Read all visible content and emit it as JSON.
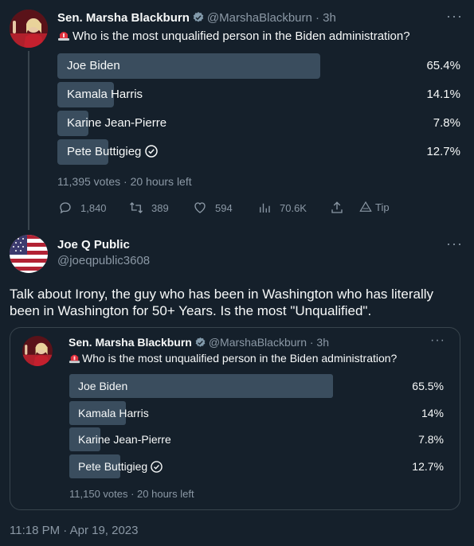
{
  "main_tweet": {
    "author_name": "Sen. Marsha Blackburn",
    "handle_time": "@MarshaBlackburn · 3h",
    "text": "Who is the most unqualified person in the Biden administration?",
    "poll": {
      "options": [
        {
          "label": "Joe Biden",
          "percent": "65.4%",
          "fraction": 0.654
        },
        {
          "label": "Kamala Harris",
          "percent": "14.1%",
          "fraction": 0.141
        },
        {
          "label": "Karine Jean-Pierre",
          "percent": "7.8%",
          "fraction": 0.078
        },
        {
          "label": "Pete Buttigieg",
          "percent": "12.7%",
          "fraction": 0.127
        }
      ],
      "meta": "11,395 votes · 20 hours left"
    },
    "actions": {
      "replies": "1,840",
      "retweets": "389",
      "likes": "594",
      "views": "70.6K",
      "tip": "Tip"
    }
  },
  "reply_tweet": {
    "author_name": "Joe Q Public",
    "handle": "@joeqpublic3608",
    "text": "Talk about Irony, the guy who has been in Washington who has literally been in Washington for 50+ Years.  Is the most \"Unqualified\".",
    "timestamp": "11:18 PM · Apr 19, 2023"
  },
  "quoted_tweet": {
    "author_name": "Sen. Marsha Blackburn",
    "handle_time": "@MarshaBlackburn · 3h",
    "text": "Who is the most unqualified person in the Biden administration?",
    "poll": {
      "options": [
        {
          "label": "Joe Biden",
          "percent": "65.5%",
          "fraction": 0.655
        },
        {
          "label": "Kamala Harris",
          "percent": "14%",
          "fraction": 0.14
        },
        {
          "label": "Karine Jean-Pierre",
          "percent": "7.8%",
          "fraction": 0.078
        },
        {
          "label": "Pete Buttigieg",
          "percent": "12.7%",
          "fraction": 0.127
        }
      ],
      "meta": "11,150 votes · 20 hours left"
    }
  },
  "icons": {
    "more": "···",
    "siren": "siren-icon",
    "verified": "verified-badge-icon",
    "check_circle": "check-circle-icon"
  },
  "colors": {
    "background": "#15202b",
    "poll_bar": "#3a4d5e",
    "verified": "#829aab",
    "muted": "#8b98a5"
  }
}
